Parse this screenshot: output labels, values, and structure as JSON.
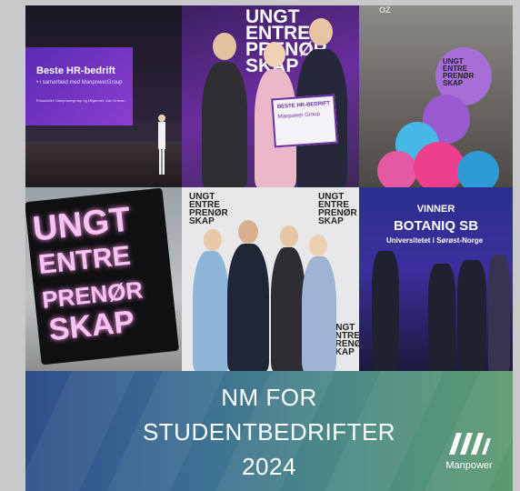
{
  "tiles": {
    "stage": {
      "screen_title": "Beste HR-bedrift",
      "screen_sub": "• i samarbeid med ManpowerGroup",
      "screen_small": "Prisutdeler:  Manpowergroup og Miljøleder: Kari Kronan"
    },
    "award": {
      "backdrop_text": [
        "UNGT",
        "ENTRE",
        "PRENØR",
        "SKAP"
      ],
      "plaque_title": "BESTE HR-BEDRIFT",
      "plaque_sub": "Manpower Group"
    },
    "balloons": {
      "sign": "OZ",
      "balloon_text": [
        "UNGT",
        "ENTRE",
        "PRENØR",
        "SKAP"
      ]
    },
    "lightbox": {
      "lines": [
        "UNGT",
        "ENTRE",
        "PRENØR",
        "SKAP"
      ]
    },
    "wall": {
      "word_lines": [
        "UNGT",
        "ENTRE",
        "PRENØR",
        "SKAP"
      ]
    },
    "winner": {
      "title": "VINNER",
      "name": "BOTANIQ SB",
      "org": "Universitetet i Sørøst-Norge"
    }
  },
  "banner": {
    "lines": [
      "NM FOR",
      "STUDENTBEDRIFTER",
      "2024"
    ],
    "logo_text": "Manpower"
  },
  "colors": {
    "banner_start": "#2f4e8a",
    "banner_end": "#5c9a6f",
    "brand_purple": "#6b2fa0",
    "neon_pink": "#f6c4f2"
  }
}
